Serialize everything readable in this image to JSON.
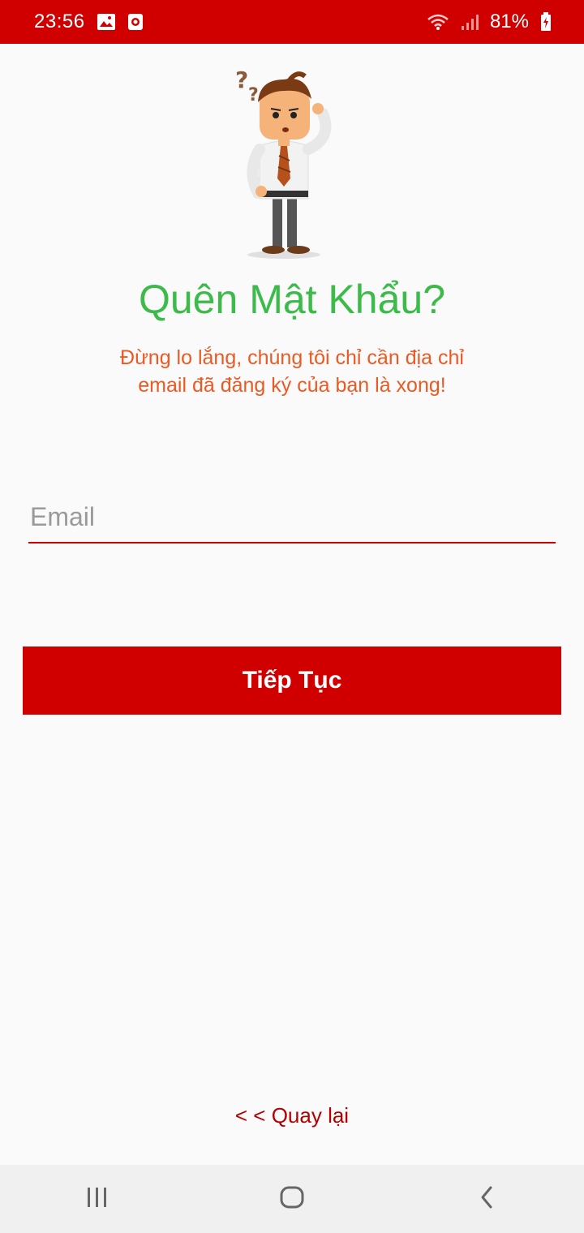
{
  "status_bar": {
    "time": "23:56",
    "battery": "81%",
    "icons": [
      "gallery-icon",
      "notification-icon",
      "wifi-icon",
      "signal-icon",
      "battery-charging-icon"
    ]
  },
  "screen": {
    "title": "Quên Mật Khẩu?",
    "subtitle": "Đừng lo lắng, chúng tôi chỉ cần địa chỉ email đã đăng ký của bạn là xong!",
    "email_placeholder": "Email",
    "continue_label": "Tiếp Tục",
    "back_label": "< < Quay lại"
  },
  "nav_bar": {
    "icons": [
      "recent-apps-icon",
      "home-icon",
      "back-icon"
    ]
  },
  "colors": {
    "primary": "#d10000",
    "title_green": "#3dbb4a",
    "subtitle_orange": "#ea5a24"
  }
}
